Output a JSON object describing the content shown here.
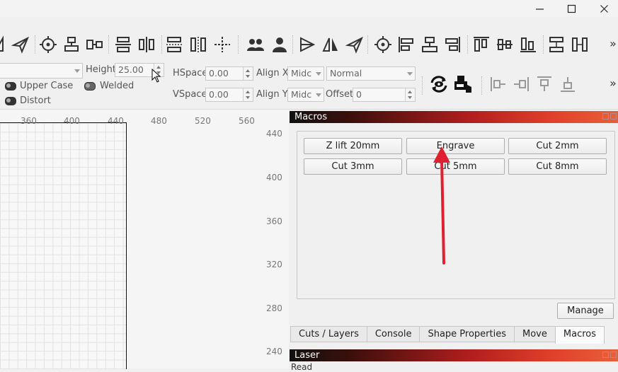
{
  "window": {
    "buttons": [
      {
        "name": "minimize",
        "glyph": "–"
      },
      {
        "name": "maximize",
        "glyph": "□"
      },
      {
        "name": "close",
        "glyph": "✕"
      }
    ]
  },
  "text_options": {
    "height_label": "Height",
    "height_value": "25.00",
    "upper_case_label": "Upper Case",
    "welded_label": "Welded",
    "distort_label": "Distort",
    "hspace_label": "HSpace",
    "hspace_value": "0.00",
    "vspace_label": "VSpace",
    "vspace_value": "0.00",
    "align_x_label": "Align X",
    "align_x_value": "Midc",
    "align_y_label": "Align Y",
    "align_y_value": "Midc",
    "mode_value": "Normal",
    "offset_label": "Offset",
    "offset_value": "0"
  },
  "ruler": {
    "top": [
      "360",
      "400",
      "440",
      "480",
      "520",
      "560"
    ],
    "right": [
      "440",
      "400",
      "360",
      "320",
      "280",
      "240"
    ]
  },
  "macros_panel": {
    "title": "Macros",
    "buttons": [
      "Z lift 20mm",
      "Engrave",
      "Cut 2mm",
      "Cut 3mm",
      "Cut 5mm",
      "Cut 8mm"
    ],
    "manage_label": "Manage",
    "tabs": [
      "Cuts / Layers",
      "Console",
      "Shape Properties",
      "Move",
      "Macros"
    ],
    "active_tab": "Macros"
  },
  "laser_panel": {
    "title": "Laser",
    "body_text": "Read"
  },
  "colors": {
    "annotation_arrow": "#e02030",
    "panel_title_start": "#111111",
    "panel_title_end": "#e8603a"
  }
}
